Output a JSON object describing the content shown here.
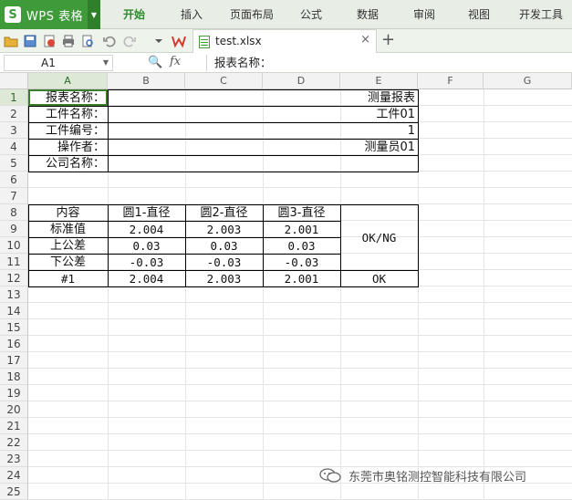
{
  "app": {
    "logo_letter": "S",
    "name": "WPS 表格"
  },
  "ribbon_tabs": [
    "开始",
    "插入",
    "页面布局",
    "公式",
    "数据",
    "审阅",
    "视图",
    "开发工具"
  ],
  "active_tab": "开始",
  "file_tab": {
    "name": "test.xlsx",
    "close": "×"
  },
  "new_tab": "+",
  "formula_bar": {
    "cell_ref": "A1",
    "fx": "fx",
    "content": "报表名称："
  },
  "columns": [
    "A",
    "B",
    "C",
    "D",
    "E",
    "F",
    "G"
  ],
  "rows": [
    "1",
    "2",
    "3",
    "4",
    "5",
    "6",
    "7",
    "8",
    "9",
    "10",
    "11",
    "12",
    "13",
    "14",
    "15",
    "16",
    "17",
    "18",
    "19",
    "20",
    "21",
    "22",
    "23",
    "24",
    "25"
  ],
  "cells": {
    "A1": "报表名称：",
    "A2": "工件名称：",
    "A3": "工件编号：",
    "A4": "操作者：",
    "A5": "公司名称：",
    "E1": "测量报表",
    "E2": "工件01",
    "E3": "1",
    "E4": "测量员01",
    "A8": "内容",
    "B8": "圆1-直径",
    "C8": "圆2-直径",
    "D8": "圆3-直径",
    "E8": "OK/NG",
    "A9": "标准值",
    "B9": "2.004",
    "C9": "2.003",
    "D9": "2.001",
    "A10": "上公差",
    "B10": "0.03",
    "C10": "0.03",
    "D10": "0.03",
    "A11": "下公差",
    "B11": "-0.03",
    "C11": "-0.03",
    "D11": "-0.03",
    "A12": "#1",
    "B12": "2.004",
    "C12": "2.003",
    "D12": "2.001",
    "E12": "OK"
  },
  "watermark": {
    "text": "东莞市奥铭测控智能科技有限公司",
    "icon": "wechat-icon"
  },
  "colors": {
    "accent_green": "#3f9a3a",
    "selection": "#3a7d2b"
  }
}
